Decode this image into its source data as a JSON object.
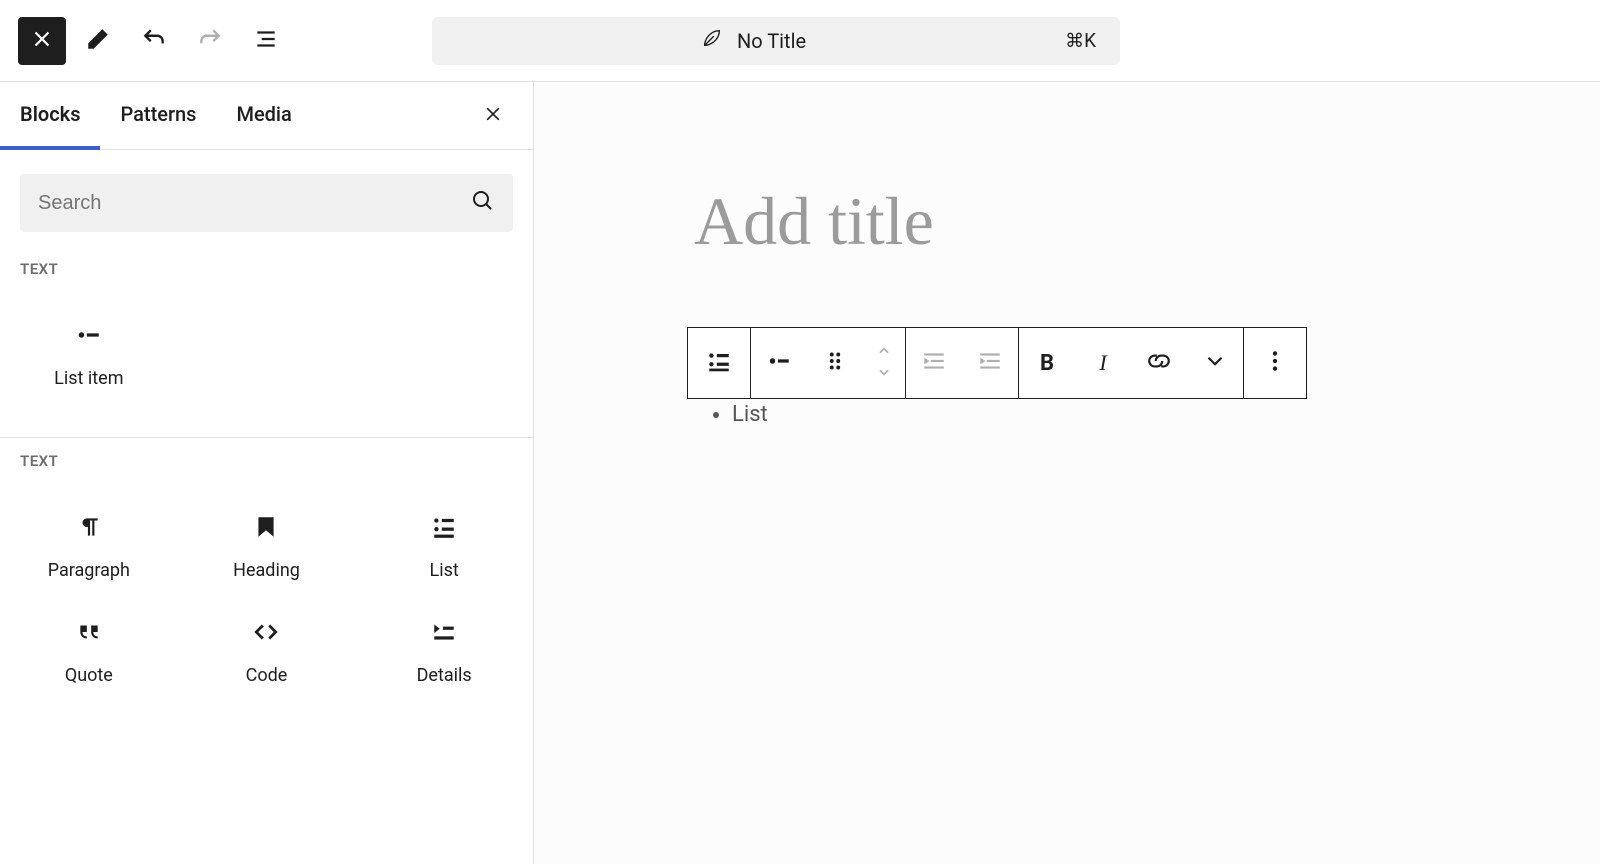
{
  "topbar": {
    "title": "No Title",
    "shortcut": "⌘K"
  },
  "tabs": {
    "blocks": "Blocks",
    "patterns": "Patterns",
    "media": "Media"
  },
  "search": {
    "placeholder": "Search"
  },
  "section1": {
    "label": "Text",
    "items": [
      {
        "label": "List item"
      }
    ]
  },
  "section2": {
    "label": "Text",
    "items": [
      {
        "label": "Paragraph"
      },
      {
        "label": "Heading"
      },
      {
        "label": "List"
      },
      {
        "label": "Quote"
      },
      {
        "label": "Code"
      },
      {
        "label": "Details"
      }
    ]
  },
  "canvas": {
    "title_placeholder": "Add title",
    "list_placeholder": "List"
  },
  "toolbar": {
    "bold": "B",
    "italic": "I"
  }
}
